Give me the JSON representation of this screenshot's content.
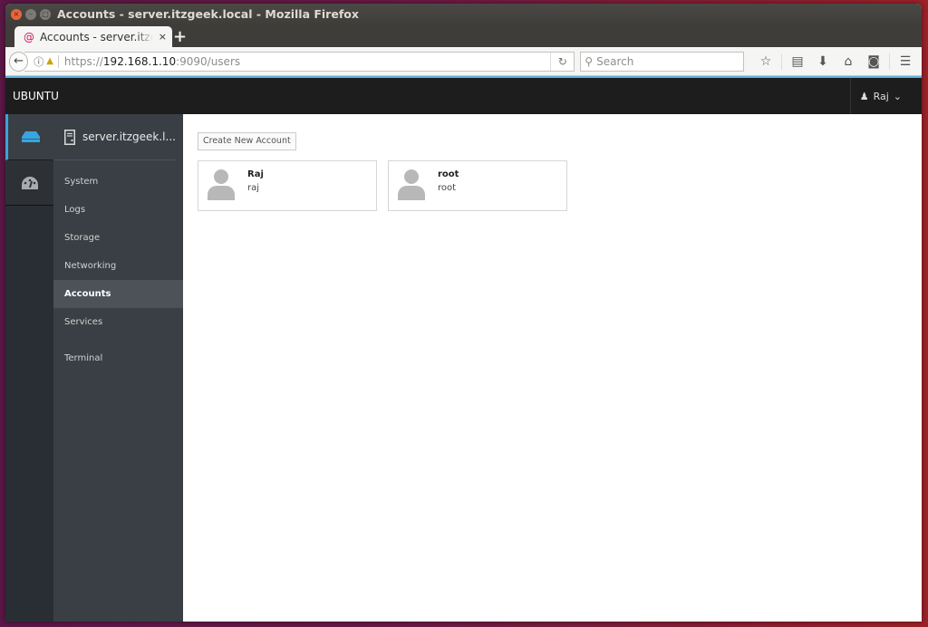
{
  "window": {
    "title": "Accounts - server.itzgeek.local - Mozilla Firefox",
    "controls": {
      "close": "×",
      "minimize": "–",
      "maximize": "□"
    }
  },
  "browser": {
    "tab": {
      "label": "Accounts - server.itzgeek.local",
      "close": "×",
      "favicon": "debian-swirl-icon"
    },
    "new_tab": "+",
    "back": "←",
    "url": {
      "scheme": "https://",
      "host": "192.168.1.10",
      "rest": ":9090/users"
    },
    "reload": "↻",
    "search": {
      "placeholder": "Search",
      "value": ""
    },
    "toolbar_icons": [
      "bookmark-star-icon",
      "reading-list-icon",
      "download-icon",
      "home-icon",
      "pocket-icon",
      "menu-icon"
    ],
    "accent_color": "#5fb0e2"
  },
  "cockpit": {
    "brand": "UBUNTU",
    "user_menu": {
      "label": "Raj",
      "caret": "⌄"
    },
    "host": "server.itzgeek.l...",
    "nav": [
      {
        "label": "System",
        "active": false
      },
      {
        "label": "Logs",
        "active": false
      },
      {
        "label": "Storage",
        "active": false
      },
      {
        "label": "Networking",
        "active": false
      },
      {
        "label": "Accounts",
        "active": true
      },
      {
        "label": "Services",
        "active": false
      },
      {
        "label": "Terminal",
        "active": false
      }
    ],
    "accent_color": "#39a5dc"
  },
  "accounts": {
    "create_label": "Create New Account",
    "list": [
      {
        "full_name": "Raj",
        "username": "raj"
      },
      {
        "full_name": "root",
        "username": "root"
      }
    ]
  }
}
